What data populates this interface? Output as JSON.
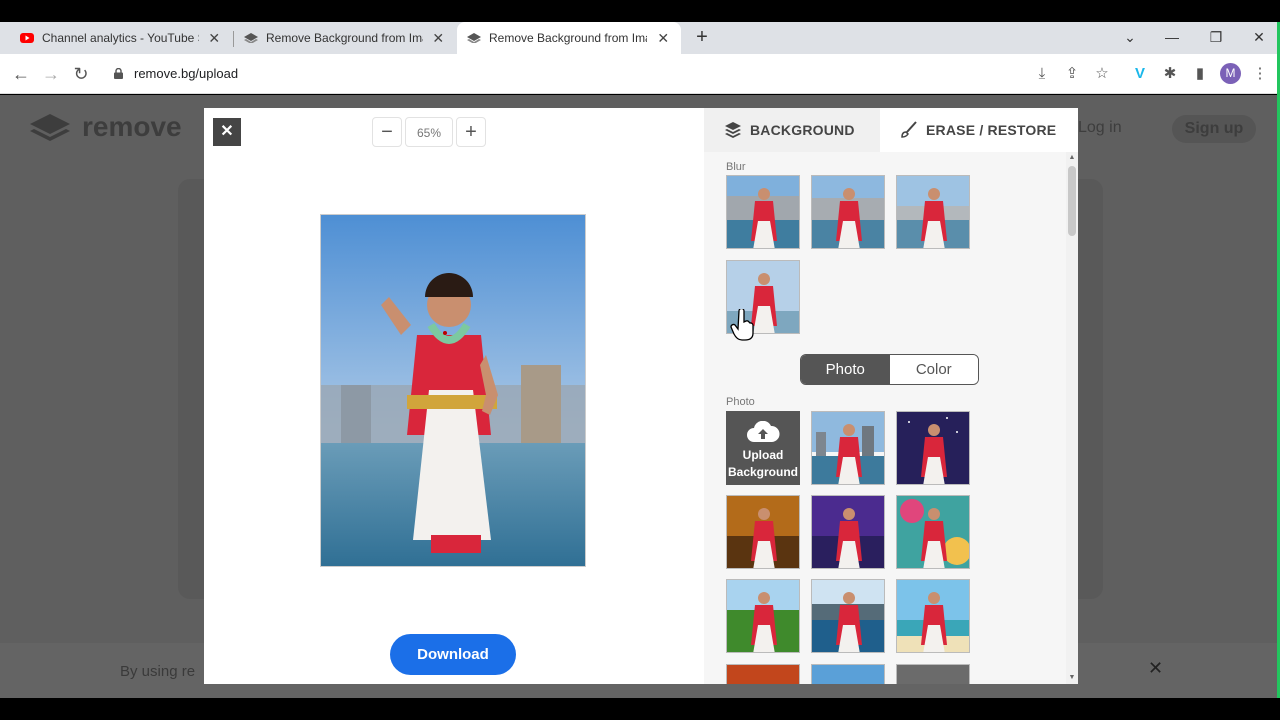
{
  "browser": {
    "tabs": [
      {
        "title": "Channel analytics - YouTube Stu",
        "favicon": "youtube-icon",
        "active": false
      },
      {
        "title": "Remove Background from Imag",
        "favicon": "removebg-icon",
        "active": false
      },
      {
        "title": "Remove Background from Imag",
        "favicon": "removebg-icon",
        "active": true
      }
    ],
    "address": "remove.bg/upload",
    "profile_initial": "M"
  },
  "page": {
    "logo_text": "remove",
    "login": "Log in",
    "signup": "Sign up",
    "cookie_text": "By using re"
  },
  "editor": {
    "zoom_value": "65%",
    "download_label": "Download",
    "tabs": {
      "background": "BACKGROUND",
      "erase_restore": "ERASE / RESTORE"
    },
    "blur_label": "Blur",
    "toggle": {
      "photo": "Photo",
      "color": "Color",
      "selected": "Photo"
    },
    "photo_label": "Photo",
    "upload_label_line1": "Upload",
    "upload_label_line2": "Background"
  },
  "colors": {
    "accent": "#1b6fe8",
    "panel_bg": "#f6f6f6",
    "dim_page": "#5f5f5f"
  }
}
